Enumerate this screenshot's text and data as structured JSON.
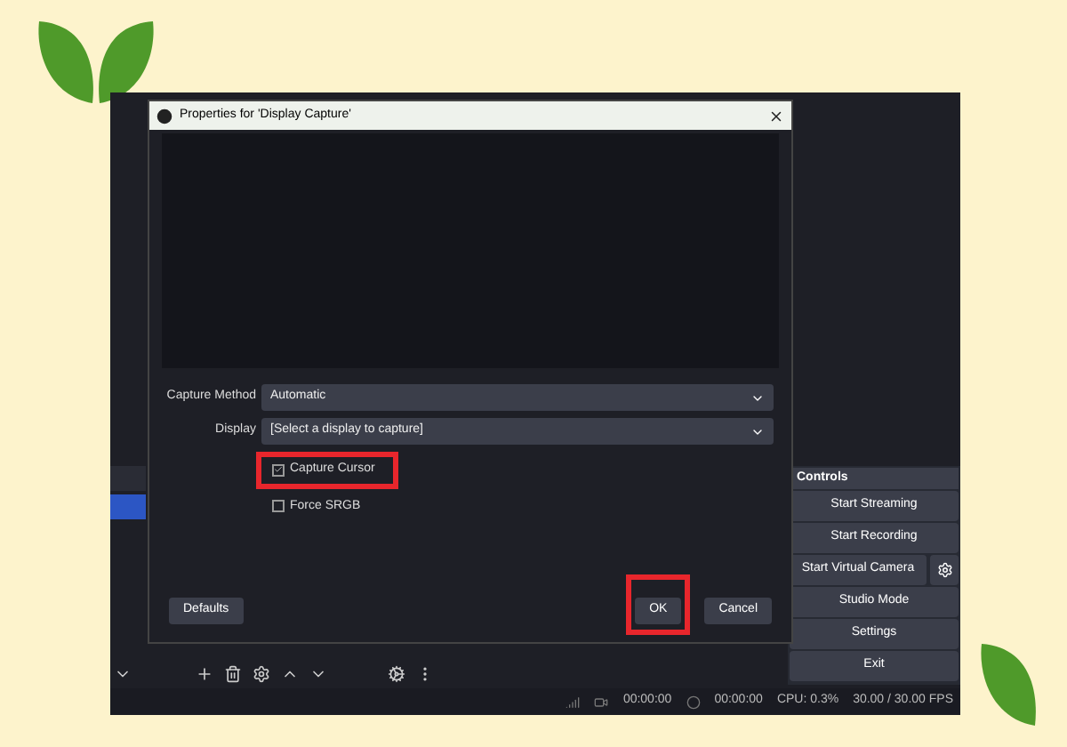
{
  "dialog": {
    "title": "Properties for 'Display Capture'",
    "fields": [
      {
        "label": "Capture Method",
        "value": "Automatic"
      },
      {
        "label": "Display",
        "value": "[Select a display to capture]"
      }
    ],
    "checkboxes": [
      {
        "label": "Capture Cursor",
        "checked": true,
        "highlighted": true
      },
      {
        "label": "Force SRGB",
        "checked": false,
        "highlighted": false
      }
    ],
    "buttons": [
      {
        "label": "Defaults",
        "kind": "left",
        "highlighted": false
      },
      {
        "label": "OK",
        "kind": "right",
        "highlighted": true
      },
      {
        "label": "Cancel",
        "kind": "right",
        "highlighted": false
      }
    ]
  },
  "scenes": {
    "items": [
      {
        "selected": false
      },
      {
        "selected": true
      }
    ]
  },
  "controls": {
    "title": "Controls",
    "buttons": [
      {
        "label": "Start Streaming",
        "has_settings": false
      },
      {
        "label": "Start Recording",
        "has_settings": false
      },
      {
        "label": "Start Virtual Camera",
        "has_settings": true
      },
      {
        "label": "Studio Mode",
        "has_settings": false
      },
      {
        "label": "Settings",
        "has_settings": false
      },
      {
        "label": "Exit",
        "has_settings": false
      }
    ]
  },
  "status_bar": {
    "times": [
      "00:00:00",
      "00:00:00"
    ],
    "cpu": "CPU: 0.3%",
    "fps": "30.00 / 30.00 FPS"
  }
}
